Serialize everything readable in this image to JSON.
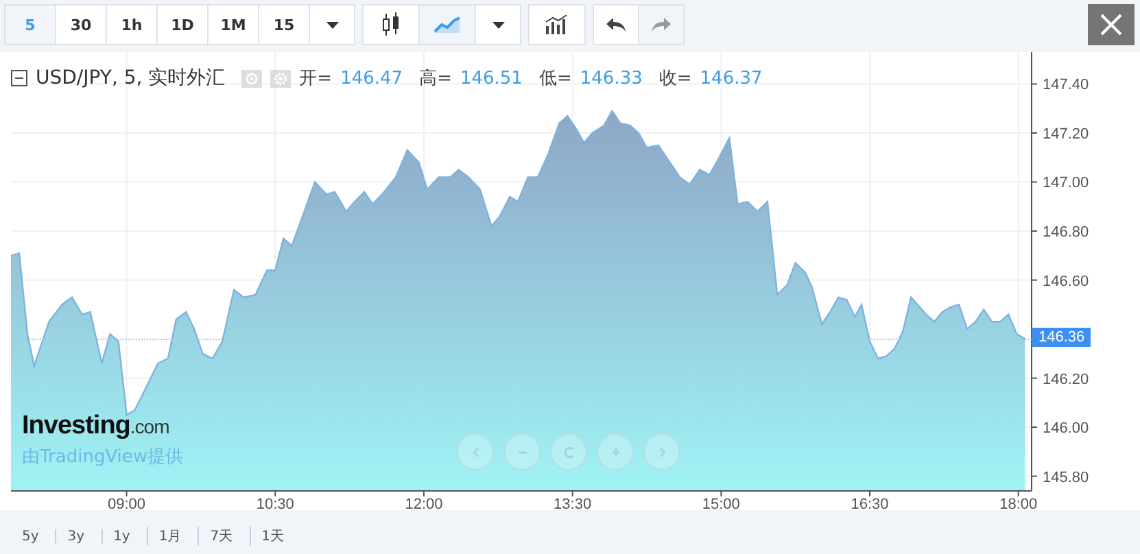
{
  "toolbar": {
    "intervals": [
      {
        "label": "5",
        "selected": true
      },
      {
        "label": "30",
        "selected": false
      },
      {
        "label": "1h",
        "selected": false
      },
      {
        "label": "1D",
        "selected": false
      },
      {
        "label": "1M",
        "selected": false
      },
      {
        "label": "15",
        "selected": false
      }
    ],
    "chart_styles": [
      {
        "kind": "candles",
        "selected": false
      },
      {
        "kind": "line",
        "selected": true
      }
    ],
    "history": [
      {
        "kind": "undo",
        "disabled": false
      },
      {
        "kind": "redo",
        "disabled": true
      }
    ]
  },
  "legend": {
    "symbol": "USD/JPY, 5, 实时外汇",
    "ohlc": [
      {
        "label": "开=",
        "value": "146.47"
      },
      {
        "label": "高=",
        "value": "146.51"
      },
      {
        "label": "低=",
        "value": "146.33"
      },
      {
        "label": "收=",
        "value": "146.37"
      }
    ]
  },
  "branding": {
    "logo_main": "Investing",
    "logo_suffix": ".com",
    "credit": "由TradingView提供"
  },
  "current_price": "146.36",
  "chart_data": {
    "type": "area",
    "grid": true,
    "xlim": [
      470,
      1088
    ],
    "ylim": [
      145.74,
      147.53
    ],
    "xticks": [
      {
        "value": 540,
        "label": "09:00"
      },
      {
        "value": 630,
        "label": "10:30"
      },
      {
        "value": 720,
        "label": "12:00"
      },
      {
        "value": 810,
        "label": "13:30"
      },
      {
        "value": 900,
        "label": "15:00"
      },
      {
        "value": 990,
        "label": "16:30"
      },
      {
        "value": 1080,
        "label": "18:00"
      }
    ],
    "yticks": [
      {
        "value": 145.8,
        "label": "145.80"
      },
      {
        "value": 146.0,
        "label": "146.00"
      },
      {
        "value": 146.2,
        "label": "146.20"
      },
      {
        "value": 146.6,
        "label": "146.60"
      },
      {
        "value": 146.8,
        "label": "146.80"
      },
      {
        "value": 147.0,
        "label": "147.00"
      },
      {
        "value": 147.2,
        "label": "147.20"
      },
      {
        "value": 147.4,
        "label": "147.40"
      }
    ],
    "x": [
      470,
      475,
      480,
      484,
      493,
      501,
      507,
      513,
      518,
      525,
      530,
      535,
      540,
      545,
      551,
      559,
      565,
      570,
      576,
      581,
      586,
      592,
      598,
      605,
      611,
      618,
      625,
      630,
      635,
      640,
      646,
      654,
      661,
      666,
      673,
      678,
      684,
      689,
      696,
      703,
      710,
      717,
      722,
      729,
      736,
      741,
      747,
      754,
      761,
      766,
      772,
      777,
      783,
      789,
      795,
      802,
      807,
      812,
      817,
      822,
      829,
      834,
      839,
      845,
      850,
      855,
      862,
      868,
      875,
      881,
      887,
      893,
      898,
      905,
      910,
      916,
      922,
      928,
      934,
      940,
      945,
      951,
      955,
      961,
      966,
      971,
      976,
      981,
      985,
      990,
      995,
      1000,
      1005,
      1010,
      1015,
      1019,
      1024,
      1029,
      1034,
      1039,
      1044,
      1049,
      1054,
      1059,
      1064,
      1069,
      1074,
      1079,
      1084
    ],
    "series": [
      {
        "color": "#7fb3df",
        "values": [
          146.7,
          146.71,
          146.38,
          146.25,
          146.43,
          146.5,
          146.53,
          146.46,
          146.47,
          146.26,
          146.38,
          146.35,
          146.05,
          146.07,
          146.15,
          146.26,
          146.28,
          146.44,
          146.47,
          146.4,
          146.3,
          146.28,
          146.35,
          146.56,
          146.53,
          146.54,
          146.64,
          146.64,
          146.77,
          146.74,
          146.85,
          147.0,
          146.95,
          146.96,
          146.88,
          146.92,
          146.96,
          146.91,
          146.96,
          147.02,
          147.13,
          147.08,
          146.97,
          147.02,
          147.02,
          147.05,
          147.02,
          146.97,
          146.82,
          146.86,
          146.94,
          146.92,
          147.02,
          147.02,
          147.11,
          147.24,
          147.27,
          147.22,
          147.16,
          147.2,
          147.23,
          147.29,
          147.24,
          147.23,
          147.2,
          147.14,
          147.15,
          147.09,
          147.02,
          146.99,
          147.05,
          147.03,
          147.09,
          147.18,
          146.91,
          146.92,
          146.88,
          146.92,
          146.54,
          146.58,
          146.67,
          146.63,
          146.57,
          146.42,
          146.47,
          146.53,
          146.52,
          146.45,
          146.5,
          146.35,
          146.28,
          146.29,
          146.32,
          146.39,
          146.53,
          146.5,
          146.46,
          146.43,
          146.47,
          146.49,
          146.5,
          146.4,
          146.43,
          146.48,
          146.43,
          146.43,
          146.46,
          146.38,
          146.36
        ]
      }
    ]
  },
  "ranges": [
    {
      "label": "5y"
    },
    {
      "label": "3y"
    },
    {
      "label": "1y"
    },
    {
      "label": "1月"
    },
    {
      "label": "7天"
    },
    {
      "label": "1天"
    }
  ]
}
